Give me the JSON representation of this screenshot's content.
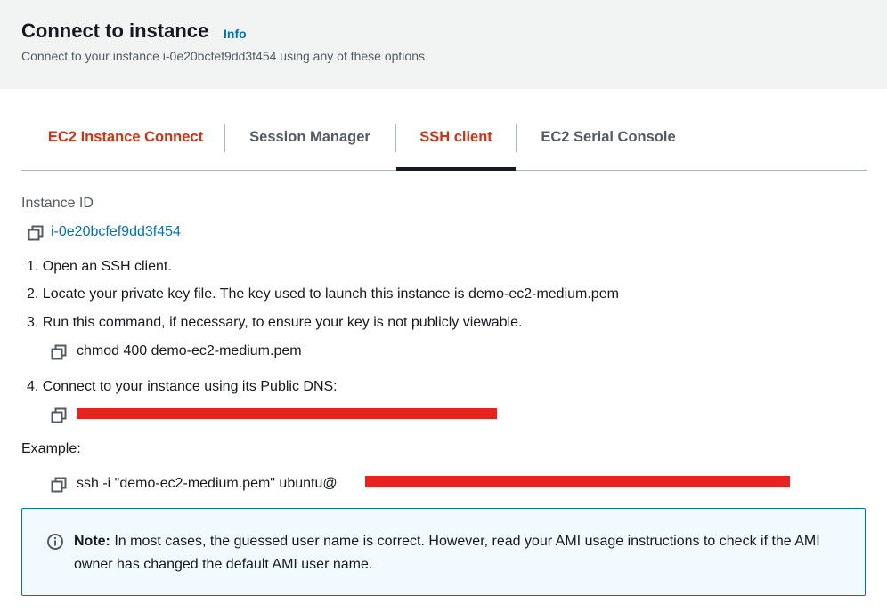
{
  "header": {
    "title": "Connect to instance",
    "info_label": "Info",
    "subtitle": "Connect to your instance i-0e20bcfef9dd3f454 using any of these options"
  },
  "tabs": [
    {
      "label": "EC2 Instance Connect"
    },
    {
      "label": "Session Manager"
    },
    {
      "label": "SSH client",
      "active": true
    },
    {
      "label": "EC2 Serial Console"
    }
  ],
  "instance": {
    "label": "Instance ID",
    "id": "i-0e20bcfef9dd3f454"
  },
  "steps": [
    "1. Open an SSH client.",
    "2. Locate your private key file. The key used to launch this instance is demo-ec2-medium.pem",
    "3. Run this command, if necessary, to ensure your key is not publicly viewable.",
    "4. Connect to your instance using its Public DNS:"
  ],
  "chmod_command": "chmod 400 demo-ec2-medium.pem",
  "example": {
    "label": "Example:",
    "command_prefix": "ssh -i \"demo-ec2-medium.pem\" ubuntu@"
  },
  "note": {
    "bold": "Note:",
    "text": " In most cases, the guessed user name is correct. However, read your AMI usage instructions to check if the AMI owner has changed the default AMI user name."
  },
  "colors": {
    "accent_red": "#d13212",
    "link_blue": "#0073bb",
    "redaction": "#e8231f",
    "note_bg": "#f1faff"
  },
  "icons": {
    "copy": "copy-icon",
    "info": "info-circle-icon"
  }
}
